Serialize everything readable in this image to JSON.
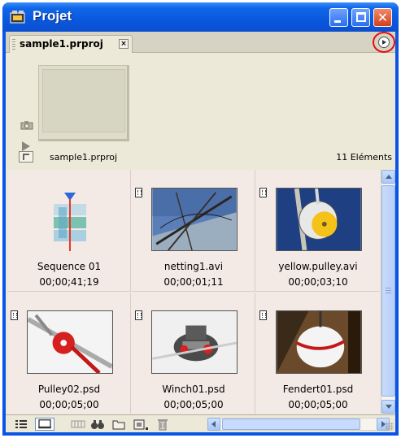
{
  "window": {
    "title": "Projet",
    "icon": "premiere-project-icon"
  },
  "tab": {
    "label": "sample1.prproj",
    "close_label": "×"
  },
  "info": {
    "project_name": "sample1.prproj",
    "item_count": "11 Eléments"
  },
  "items": [
    {
      "name": "Sequence 01",
      "duration": "00;00;41;19",
      "type": "sequence"
    },
    {
      "name": "netting1.avi",
      "duration": "00;00;01;11",
      "type": "video"
    },
    {
      "name": "yellow.pulley.avi",
      "duration": "00;00;03;10",
      "type": "video"
    },
    {
      "name": "Pulley02.psd",
      "duration": "00;00;05;00",
      "type": "still"
    },
    {
      "name": "Winch01.psd",
      "duration": "00;00;05;00",
      "type": "still"
    },
    {
      "name": "Fendert01.psd",
      "duration": "00;00;05;00",
      "type": "still"
    }
  ],
  "toolbar": {
    "icons": [
      "list-view-icon",
      "icon-view-icon",
      "automate-to-sequence-icon",
      "find-icon",
      "new-bin-icon",
      "new-item-icon",
      "delete-icon"
    ]
  },
  "colors": {
    "title_bar": "#0a58de",
    "grid_background": "#f3e9e5",
    "highlight_circle": "#e01010"
  }
}
